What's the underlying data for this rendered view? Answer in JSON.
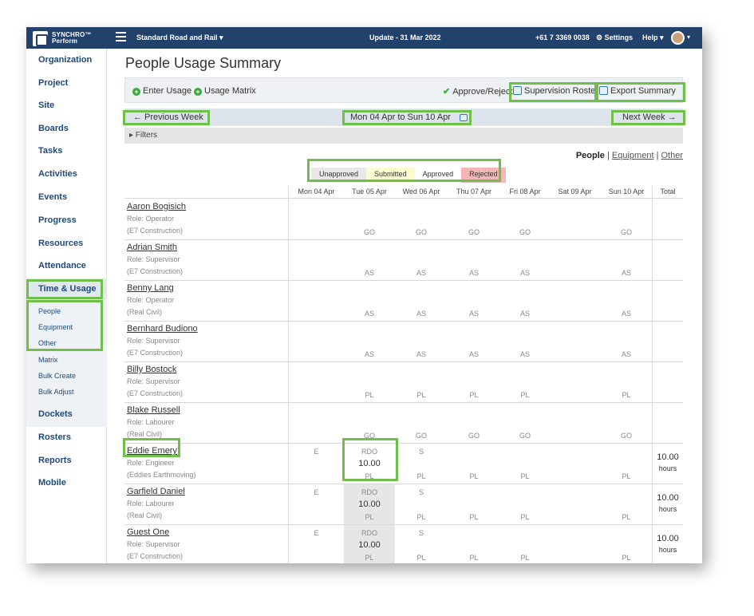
{
  "topbar": {
    "logo_line1": "SYNCHRO™",
    "logo_line2": "Perform",
    "project": "Standard Road and Rail ▾",
    "update": "Update - 31 Mar 2022",
    "phone": "+61 7 3369 0038",
    "settings": "⚙ Settings",
    "help": "Help ▾",
    "avatar_caret": "▾"
  },
  "sidebar": {
    "items": [
      "Organization",
      "Project",
      "Site",
      "Boards",
      "Tasks",
      "Activities",
      "Events",
      "Progress",
      "Resources",
      "Attendance",
      "Time & Usage"
    ],
    "subitems": [
      "People",
      "Equipment",
      "Other",
      "Matrix",
      "Bulk Create",
      "Bulk Adjust"
    ],
    "items_bottom": [
      "Dockets",
      "Rosters",
      "Reports",
      "Mobile"
    ]
  },
  "page": {
    "title": "People Usage Summary",
    "enter_usage": "Enter Usage",
    "usage_matrix": "Usage Matrix",
    "approve_reject": "Approve/Reject",
    "supervision_roster": "Supervision Roster",
    "export_summary": "Export Summary",
    "prev_week": "← Previous Week",
    "week_range": "Mon 04 Apr to Sun 10 Apr",
    "next_week": "Next Week →",
    "filters": "▸ Filters",
    "view_people": "People",
    "view_equipment": "Equipment",
    "view_other": "Other",
    "sep": "|"
  },
  "legend": [
    {
      "label": "Unapproved",
      "color": "#e8e8e8"
    },
    {
      "label": "Submitted",
      "color": "#fbfbd0"
    },
    {
      "label": "Approved",
      "color": "#ffffff"
    },
    {
      "label": "Rejected",
      "color": "#f4b6b6"
    }
  ],
  "columns": [
    "Mon 04 Apr",
    "Tue 05 Apr",
    "Wed 06 Apr",
    "Thu 07 Apr",
    "Fri 08 Apr",
    "Sat 09 Apr",
    "Sun 10 Apr",
    "Total"
  ],
  "rows": [
    {
      "name": "Aaron Bogisich",
      "role": "Role: Operator",
      "company": "(E7 Construction)",
      "cells": [
        "",
        "GO",
        "GO",
        "GO",
        "GO",
        "",
        "GO"
      ],
      "total": ""
    },
    {
      "name": "Adrian Smith",
      "role": "Role: Supervisor",
      "company": "(E7 Construction)",
      "cells": [
        "",
        "AS",
        "AS",
        "AS",
        "AS",
        "",
        "AS"
      ],
      "total": ""
    },
    {
      "name": "Benny Lang",
      "role": "Role: Operator",
      "company": "(Real Civil)",
      "cells": [
        "",
        "AS",
        "AS",
        "AS",
        "AS",
        "",
        "AS"
      ],
      "total": ""
    },
    {
      "name": "Bernhard Budiono",
      "role": "Role: Supervisor",
      "company": "(E7 Construction)",
      "cells": [
        "",
        "AS",
        "AS",
        "AS",
        "AS",
        "",
        "AS"
      ],
      "total": ""
    },
    {
      "name": "Billy Bostock",
      "role": "Role: Supervisor",
      "company": "(E7 Construction)",
      "cells": [
        "",
        "PL",
        "PL",
        "PL",
        "PL",
        "",
        "PL"
      ],
      "total": ""
    },
    {
      "name": "Blake Russell",
      "role": "Role: Labourer",
      "company": "(Real Civil)",
      "cells": [
        "",
        "GO",
        "GO",
        "GO",
        "GO",
        "",
        "GO"
      ],
      "total": ""
    },
    {
      "name": "Eddie Emery",
      "role": "Role: Engineer",
      "company": "(Eddies Earthmoving)",
      "top": [
        "E",
        "RDO",
        "S",
        "",
        "",
        "",
        ""
      ],
      "hours": [
        "",
        "10.00",
        "",
        "",
        "",
        "",
        ""
      ],
      "cells": [
        "",
        "PL",
        "PL",
        "PL",
        "PL",
        "",
        "PL"
      ],
      "total": "10.00",
      "total_unit": "hours"
    },
    {
      "name": "Garfield Daniel",
      "role": "Role: Labourer",
      "company": "(Real Civil)",
      "top": [
        "E",
        "RDO",
        "S",
        "",
        "",
        "",
        ""
      ],
      "hours": [
        "",
        "10.00",
        "",
        "",
        "",
        "",
        ""
      ],
      "cells": [
        "",
        "PL",
        "PL",
        "PL",
        "PL",
        "",
        "PL"
      ],
      "total": "10.00",
      "total_unit": "hours"
    },
    {
      "name": "Guest One",
      "role": "Role: Supervisor",
      "company": "(E7 Construction)",
      "top": [
        "E",
        "RDO",
        "S",
        "",
        "",
        "",
        ""
      ],
      "hours": [
        "",
        "10.00",
        "",
        "",
        "",
        "",
        ""
      ],
      "cells": [
        "",
        "PL",
        "PL",
        "PL",
        "PL",
        "",
        "PL"
      ],
      "total": "10.00",
      "total_unit": "hours"
    }
  ]
}
